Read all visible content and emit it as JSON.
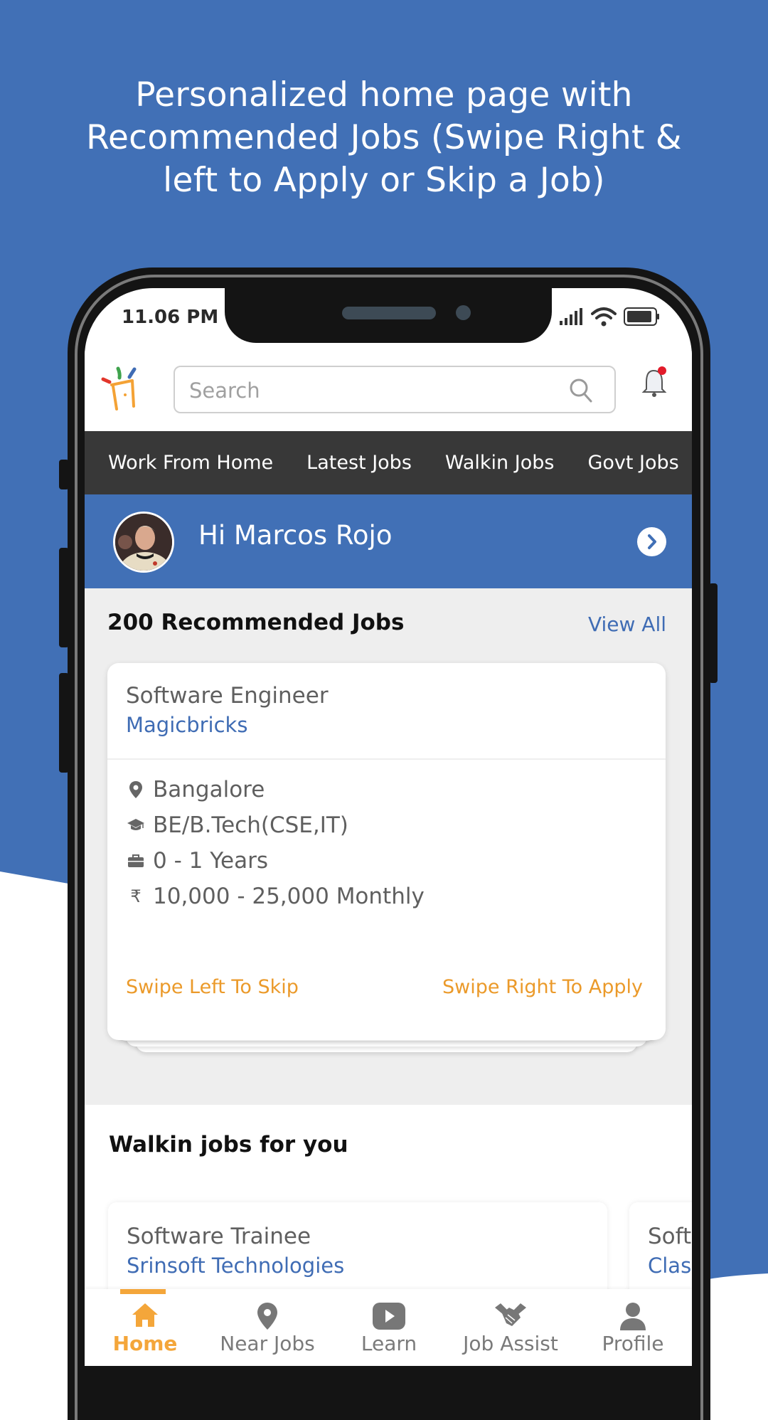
{
  "promo": {
    "title_line1": "Personalized home page with",
    "title_line2": "Recommended Jobs (Swipe Right &",
    "title_line3": "left to Apply or Skip a Job)"
  },
  "colors": {
    "brand_blue": "#4170b6",
    "dark_nav": "#383838",
    "accent_orange": "#eb9a2a",
    "link_blue": "#3f6cb4"
  },
  "status_bar": {
    "time": "11.06 PM",
    "icons": [
      "signal-icon",
      "wifi-icon",
      "battery-icon"
    ]
  },
  "header": {
    "logo": "app-logo",
    "search_placeholder": "Search",
    "search_value": "",
    "icons": [
      "search-icon",
      "bell-icon"
    ],
    "notification_dot": true
  },
  "category_tabs": [
    {
      "label": "Work From Home"
    },
    {
      "label": "Latest Jobs"
    },
    {
      "label": "Walkin Jobs"
    },
    {
      "label": "Govt Jobs"
    }
  ],
  "greeting": {
    "text": "Hi Marcos Rojo",
    "icon": "chevron-right-icon"
  },
  "recommended": {
    "title": "200 Recommended Jobs",
    "view_all": "View All",
    "card": {
      "title": "Software Engineer",
      "company": "Magicbricks",
      "location": "Bangalore",
      "qualification": "BE/B.Tech(CSE,IT)",
      "experience": "0 - 1 Years",
      "salary": "10,000 - 25,000 Monthly",
      "currency_symbol": "₹",
      "swipe_left": "Swipe Left To Skip",
      "swipe_right": "Swipe Right To Apply"
    }
  },
  "walkin": {
    "title": "Walkin jobs for you",
    "cards": [
      {
        "title": "Software Trainee",
        "company": "Srinsoft Technologies"
      },
      {
        "title": "Software",
        "company": "Clas"
      }
    ]
  },
  "bottom_nav": [
    {
      "label": "Home",
      "icon": "home-icon",
      "active": true
    },
    {
      "label": "Near Jobs",
      "icon": "map-pin-icon",
      "active": false
    },
    {
      "label": "Learn",
      "icon": "play-icon",
      "active": false
    },
    {
      "label": "Job Assist",
      "icon": "handshake-icon",
      "active": false
    },
    {
      "label": "Profile",
      "icon": "user-icon",
      "active": false
    }
  ]
}
